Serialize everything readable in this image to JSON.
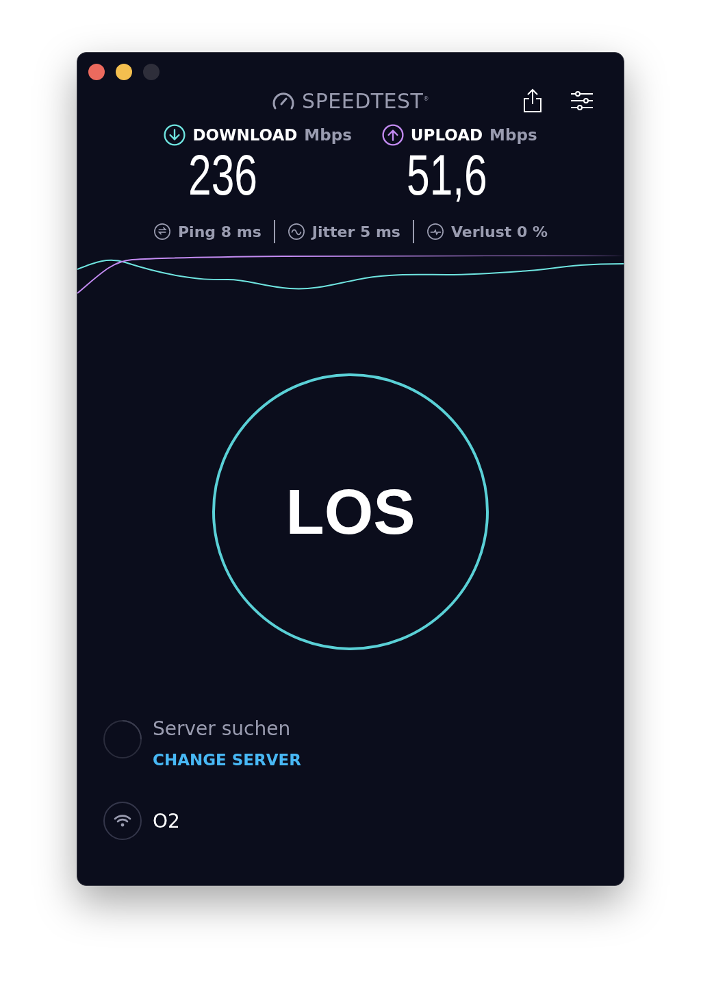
{
  "window_controls": [
    {
      "color": "#ec6a5e"
    },
    {
      "color": "#f4bf4f"
    },
    {
      "color": "#2e2e3a"
    }
  ],
  "logo": {
    "text": "SPEEDTEST$^{®}$"
  },
  "metrics": [
    {
      "kind": "download",
      "label": "DOWNLOAD",
      "unit": "Mbps",
      "value": "236"
    },
    {
      "kind": "upload",
      "label": "UPLOAD",
      "unit": "Mbps",
      "value": "51,6"
    }
  ],
  "stats": [
    {
      "kind": "ping",
      "text": "Ping 8 ms"
    },
    {
      "kind": "jitter",
      "text": "Jitter 5 ms"
    },
    {
      "kind": "loss",
      "text": "Verlust 0 %"
    }
  ],
  "go_button": {
    "label": "LOS"
  },
  "server": {
    "status": "Server suchen",
    "action": "CHANGE SERVER"
  },
  "network": {
    "name": "O2"
  }
}
